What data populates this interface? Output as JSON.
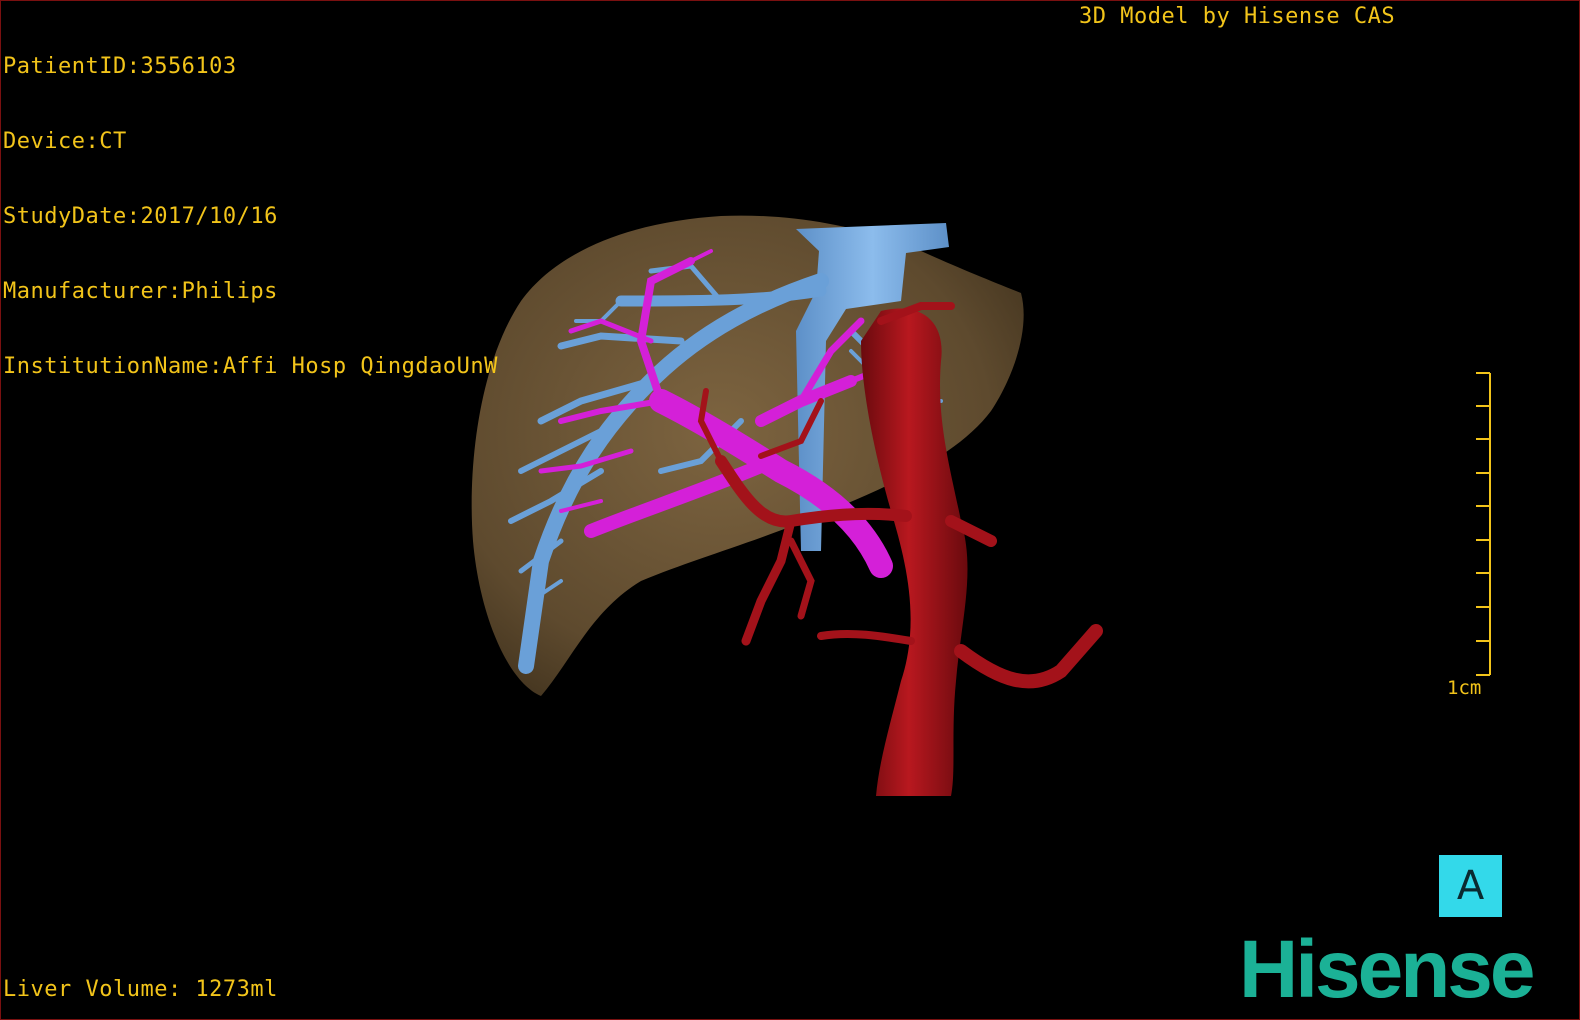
{
  "header": {
    "patient_id": "PatientID:3556103",
    "device": "Device:CT",
    "study_date": "StudyDate:2017/10/16",
    "manufacturer": "Manufacturer:Philips",
    "institution": "InstitutionName:Affi Hosp QingdaoUnW",
    "model_credit": "3D Model by Hisense CAS"
  },
  "footer": {
    "liver_volume": "Liver Volume: 1273ml"
  },
  "scale_bar": {
    "label": "1cm"
  },
  "orientation": {
    "label": "A"
  },
  "brand": {
    "logo_text": "Hisense"
  },
  "colors": {
    "overlay_text": "#f2c41a",
    "liver": "#6b5434",
    "hepatic_vein": "#6a9fd6",
    "portal_vein": "#d21fd6",
    "artery": "#a2121a",
    "orientation_box": "#33d9ea",
    "logo": "#1bb196"
  }
}
